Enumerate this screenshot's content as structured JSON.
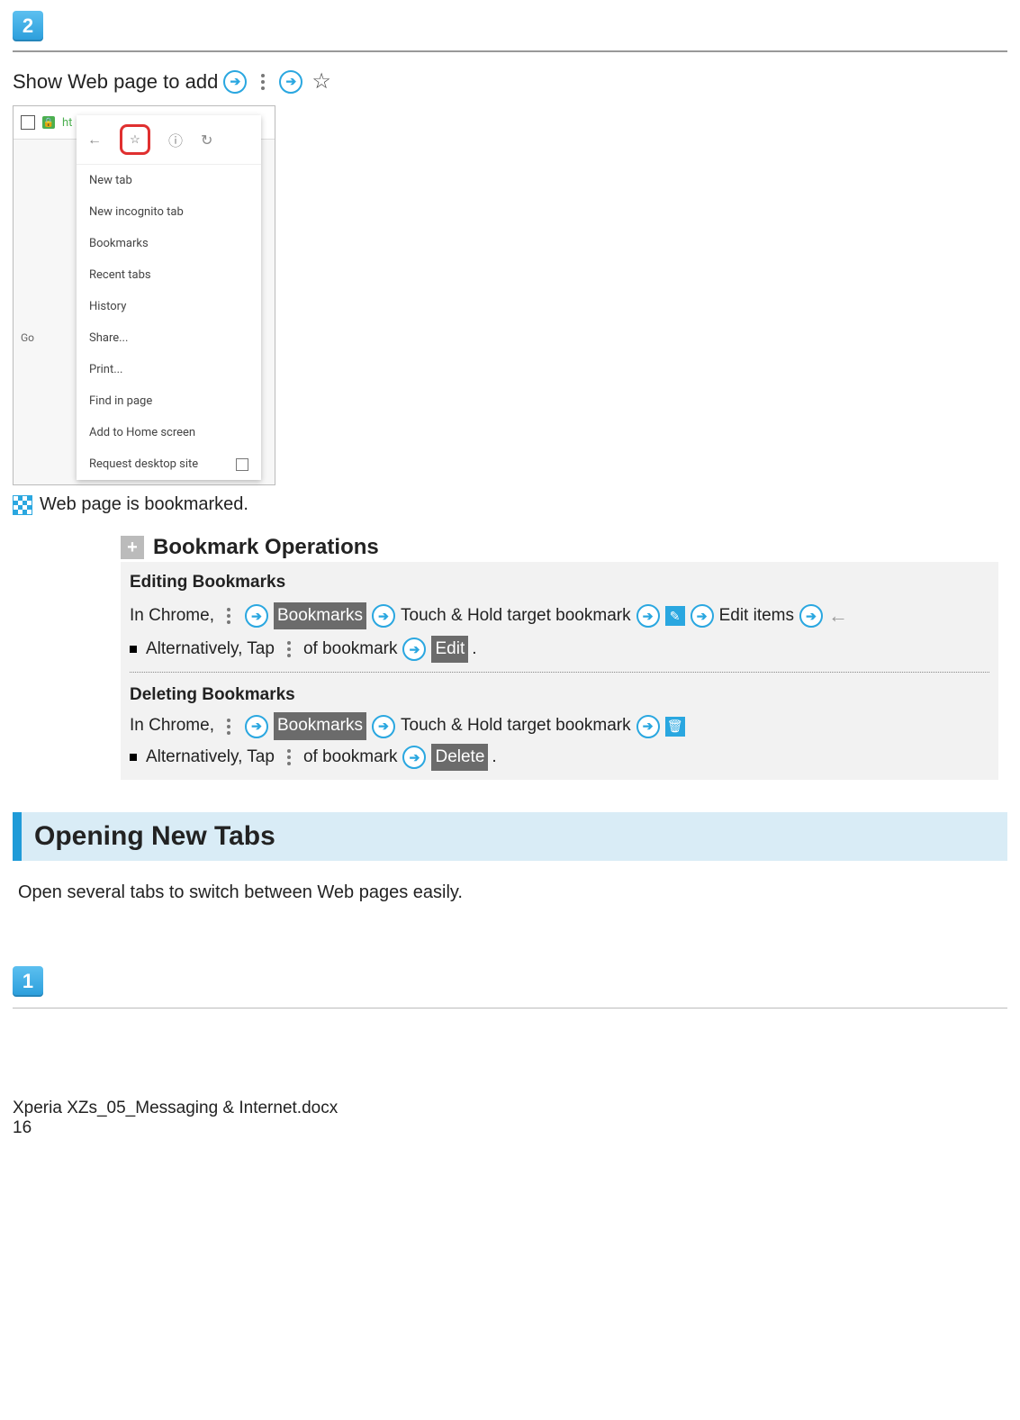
{
  "steps": {
    "two": "2",
    "one": "1"
  },
  "line1": "Show Web page to add",
  "menu": {
    "url_prefix": "ht",
    "items": [
      "New tab",
      "New incognito tab",
      "Bookmarks",
      "Recent tabs",
      "History",
      "Share...",
      "Print...",
      "Find in page",
      "Add to Home screen",
      "Request desktop site"
    ],
    "bg_label": "Go"
  },
  "flag_line": "Web page is bookmarked.",
  "ops": {
    "title": "Bookmark Operations",
    "edit_h": "Editing Bookmarks",
    "in_chrome": "In Chrome,",
    "bookmarks_btn": "Bookmarks",
    "touch_hold": "Touch & Hold target bookmark",
    "edit_items": "Edit items",
    "alt_prefix": "Alternatively, Tap",
    "of_bookmark": "of bookmark",
    "edit_btn": "Edit",
    "del_h": "Deleting Bookmarks",
    "delete_btn": "Delete"
  },
  "section": "Opening New Tabs",
  "section_body": "Open several tabs to switch between Web pages easily.",
  "footer_doc": "Xperia XZs_05_Messaging & Internet.docx",
  "footer_page": "16"
}
